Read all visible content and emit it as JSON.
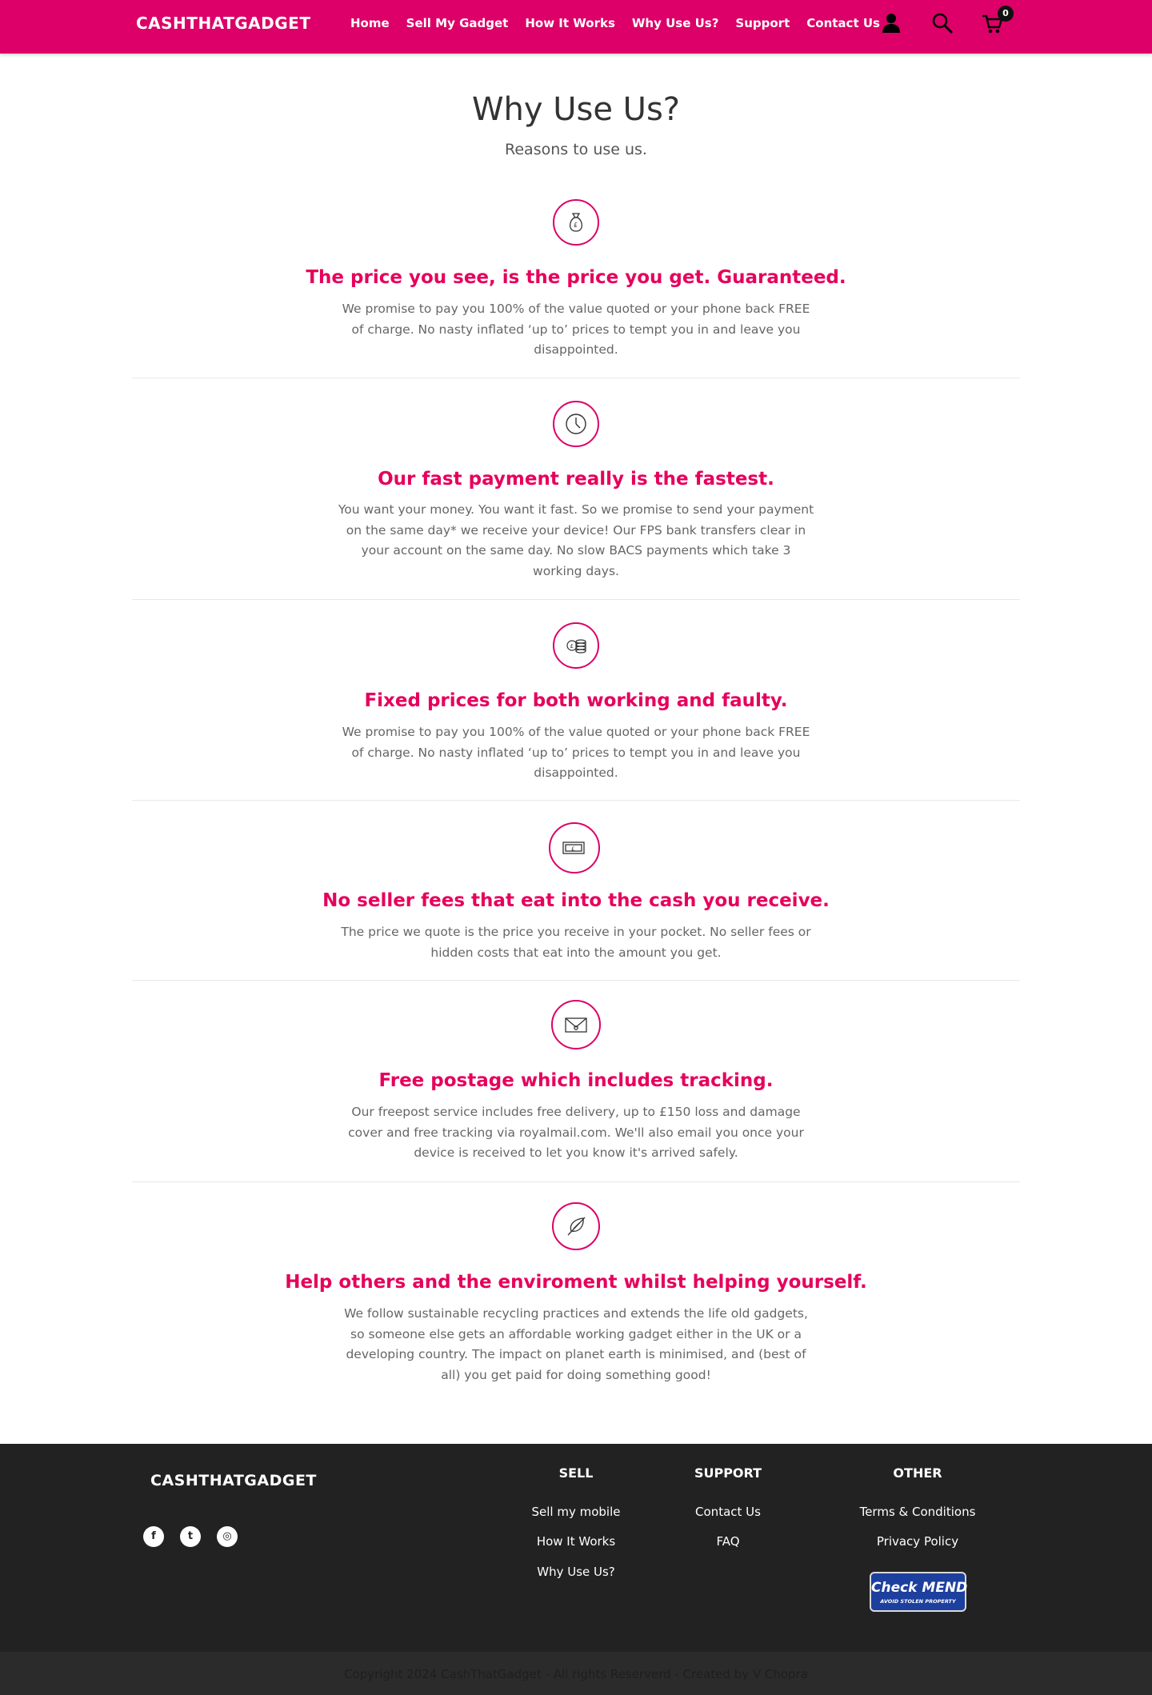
{
  "header": {
    "logo": "CASHTHATGADGET",
    "nav": [
      "Home",
      "Sell My Gadget",
      "How It Works",
      "Why Use Us?",
      "Support",
      "Contact Us"
    ],
    "cart_count": "0",
    "brand_color": "#dc0068",
    "icons": [
      "user-icon",
      "search-icon",
      "cart-icon"
    ]
  },
  "intro": {
    "title": "Why Use Us?",
    "subtitle": "Reasons to use us."
  },
  "features": [
    {
      "icon": "money-bag-icon",
      "title": "The price you see, is the price you get. Guaranteed.",
      "text": "We promise to pay you 100% of the value quoted or your phone back FREE of charge. No nasty inflated ‘up to’ prices to tempt you in and leave you disappointed."
    },
    {
      "icon": "clock-icon",
      "title": "Our fast payment really is the fastest.",
      "text": "You want your money. You want it fast. So we promise to send your payment on the same day* we receive your device! Our FPS bank transfers clear in your account on the same day. No slow BACS payments which take 3 working days."
    },
    {
      "icon": "coins-icon",
      "title": "Fixed prices for both working and faulty.",
      "text": "We promise to pay you 100% of the value quoted or your phone back FREE of charge. No nasty inflated ‘up to’ prices to tempt you in and leave you disappointed."
    },
    {
      "icon": "banknote-icon",
      "title": "No seller fees that eat into the cash you receive.",
      "text": "The price we quote is the price you receive in your pocket. No seller fees or hidden costs that eat into the amount you get."
    },
    {
      "icon": "envelope-icon",
      "title": "Free postage which includes tracking.",
      "text": "Our freepost service includes free delivery, up to £150 loss and damage cover and free tracking via royalmail.com. We'll also email you once your device is received to let you know it's arrived safely."
    },
    {
      "icon": "leaf-icon",
      "title": "Help others and the enviroment whilst helping yourself.",
      "text": "We follow sustainable recycling practices and extends the life old gadgets, so someone else gets an affordable working gadget either in the UK or a developing country. The impact on planet earth is minimised, and (best of all) you get paid for doing something good!"
    }
  ],
  "footer": {
    "logo": "CASHTHATGADGET",
    "social": [
      "facebook-icon",
      "twitter-icon",
      "instagram-icon"
    ],
    "social_glyphs": [
      "f",
      "t",
      "◎"
    ],
    "sell": {
      "heading": "SELL",
      "links": [
        "Sell my mobile",
        "How It Works",
        "Why Use Us?"
      ]
    },
    "support": {
      "heading": "SUPPORT",
      "links": [
        "Contact Us",
        "FAQ"
      ]
    },
    "other": {
      "heading": "OTHER",
      "links": [
        "Terms & Conditions",
        "Privacy Policy"
      ]
    },
    "badge": {
      "main": "Check MEND",
      "sub": "AVOID STOLEN PROPERTY"
    },
    "copyright": "Copyright 2024 CashThatGadget - All rights Reserverd - Created by V Chopra"
  }
}
